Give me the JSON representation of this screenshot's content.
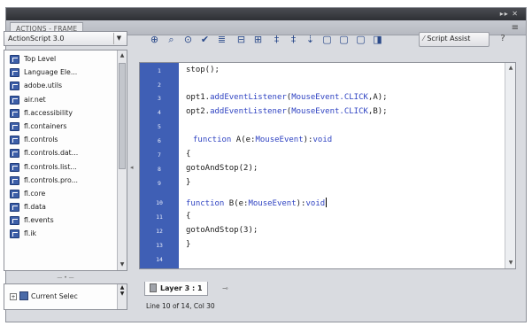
{
  "window": {
    "tab_title": "ACTIONS - FRAME"
  },
  "language_select": {
    "value": "ActionScript 3.0"
  },
  "tree": {
    "items": [
      "Top Level",
      "Language Ele...",
      "adobe.utils",
      "air.net",
      "fl.accessibility",
      "fl.containers",
      "fl.controls",
      "fl.controls.dat...",
      "fl.controls.list...",
      "fl.controls.pro...",
      "fl.core",
      "fl.data",
      "fl.events",
      "fl.ik"
    ]
  },
  "script_nav": {
    "item": "Current Selec"
  },
  "toolbar": {
    "script_assist": "Script Assist",
    "help": "?"
  },
  "editor": {
    "line_numbers": [
      "1",
      "2",
      "3",
      "4",
      "5",
      "6",
      "7",
      "8",
      "9",
      "10",
      "11",
      "12",
      "13",
      "14"
    ]
  },
  "code": {
    "l1": "stop();",
    "l3a": "opt1.",
    "l3b": "addEventListener",
    "l3c": "(",
    "l3d": "MouseEvent.CLICK",
    "l3e": ",A);",
    "l4a": "opt2.",
    "l4b": "addEventListener",
    "l4c": "(",
    "l4d": "MouseEvent.CLICK",
    "l4e": ",B);",
    "l6a": "function",
    "l6b": " A(e:",
    "l6c": "MouseEvent",
    "l6d": "):",
    "l6e": "void",
    "l7": "{",
    "l8": "gotoAndStop(2);",
    "l9": "}",
    "l10a": "function",
    "l10b": " B(e:",
    "l10c": "MouseEvent",
    "l10d": "):",
    "l10e": "void",
    "l11": "{",
    "l12": "gotoAndStop(3);",
    "l13": "}"
  },
  "layer_tab": {
    "label": "Layer 3 : 1"
  },
  "status": {
    "text": "Line 10 of 14, Col 30"
  }
}
